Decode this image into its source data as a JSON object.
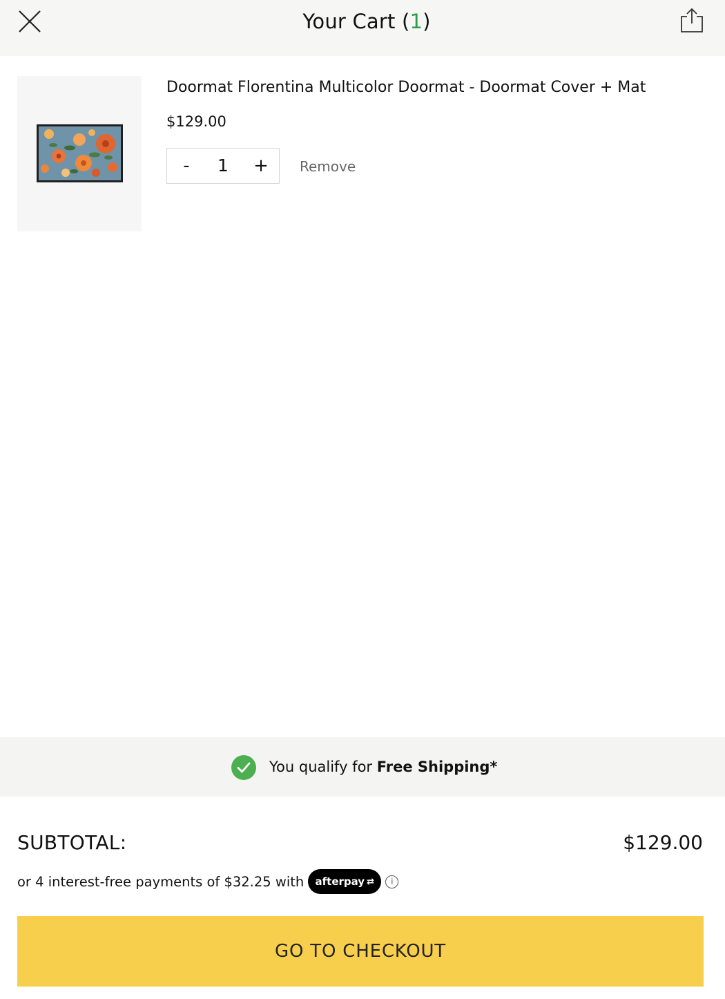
{
  "header": {
    "title_prefix": "Your Cart (",
    "count": "1",
    "title_suffix": ")",
    "close_icon": "close-icon",
    "share_icon": "share-icon"
  },
  "cart": {
    "items": [
      {
        "name": "Doormat Florentina Multicolor Doormat - Doormat Cover + Mat",
        "price": "$129.00",
        "quantity": "1",
        "minus_label": "-",
        "plus_label": "+",
        "remove_label": "Remove"
      }
    ]
  },
  "shipping": {
    "text_prefix": "You qualify for ",
    "text_bold": "Free Shipping*",
    "icon": "check-circle-icon"
  },
  "summary": {
    "subtotal_label": "SUBTOTAL:",
    "subtotal_value": "$129.00",
    "installments_text": "or 4 interest-free payments of $32.25 with",
    "afterpay_label": "afterpay",
    "info_icon": "info-icon"
  },
  "checkout": {
    "label": "GO TO CHECKOUT"
  },
  "colors": {
    "accent_yellow": "#f8cf4d",
    "success_green": "#4caf50",
    "count_green": "#2e9b4a"
  }
}
